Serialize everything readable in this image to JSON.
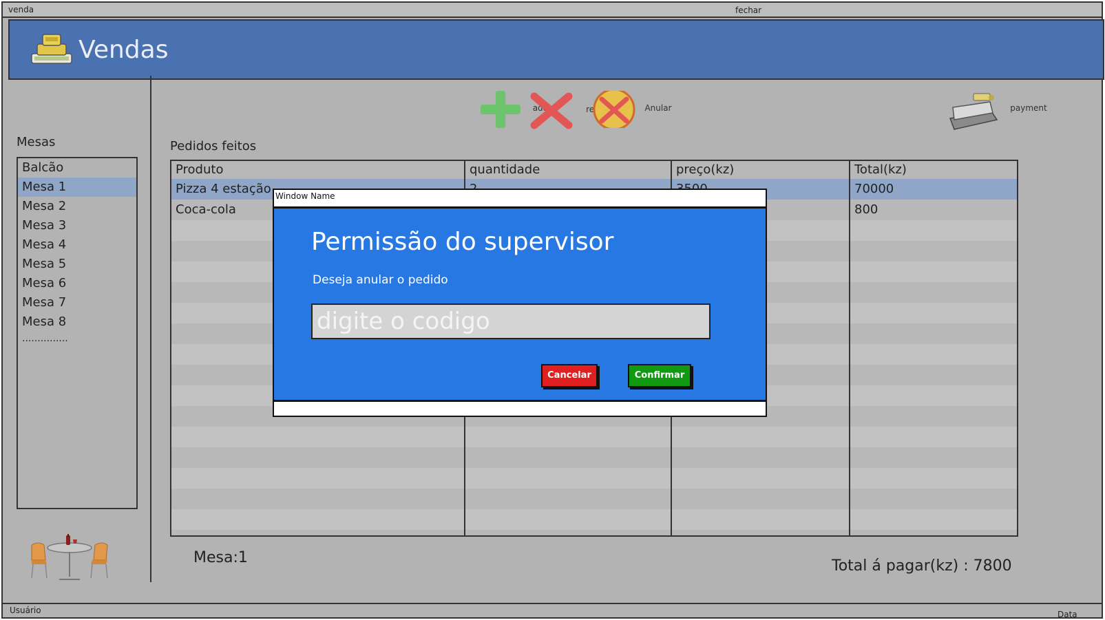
{
  "window": {
    "title": "venda",
    "close_label": "fechar"
  },
  "header": {
    "title": "Vendas",
    "logo_icon": "cash-register-icon"
  },
  "sidebar": {
    "label": "Mesas",
    "items": [
      "Balcão",
      "Mesa 1",
      "Mesa 2",
      "Mesa 3",
      "Mesa 4",
      "Mesa 5",
      "Mesa 6",
      "Mesa 7",
      "Mesa 8"
    ],
    "selected": "Mesa 1",
    "more": "..............."
  },
  "toolbar": {
    "add_label": "add",
    "rem_label": "rem",
    "anular_label": "Anular",
    "payment_label": "payment"
  },
  "orders": {
    "label": "Pedidos feitos",
    "columns": [
      "Produto",
      "quantidade",
      "preço(kz)",
      "Total(kz)"
    ],
    "rows": [
      {
        "produto": "Pizza 4 estação",
        "quantidade": "2",
        "preco": "3500",
        "total": "70000"
      },
      {
        "produto": "Coca-cola",
        "quantidade": "",
        "preco": "",
        "total": "800"
      }
    ]
  },
  "footer": {
    "mesa": "Mesa:1",
    "total": "Total á pagar(kz) : 7800"
  },
  "statusbar": {
    "user": "Usuário",
    "date": "Data"
  },
  "dialog": {
    "window_name": "Window Name",
    "heading": "Permissão do supervisor",
    "message": "Deseja anular o pedido",
    "input_placeholder": "digite o codigo",
    "input_value": "",
    "cancel_label": "Cancelar",
    "confirm_label": "Confirmar"
  },
  "colors": {
    "header_bg": "#4a72b0",
    "dialog_bg": "#2878e3",
    "selection": "#8fa6c8",
    "cancel": "#e02020",
    "confirm": "#119911"
  }
}
